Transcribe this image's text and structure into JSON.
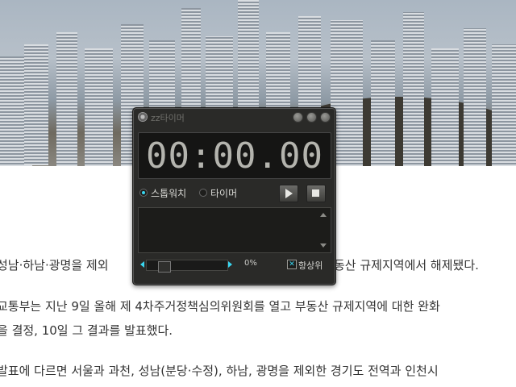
{
  "window": {
    "title": "zz타이머"
  },
  "display": {
    "time": "00:00.00"
  },
  "modes": [
    {
      "label": "스톱워치",
      "selected": true
    },
    {
      "label": "타이머",
      "selected": false
    }
  ],
  "controls": {
    "play": "play-icon",
    "stop": "stop-icon"
  },
  "bottom": {
    "opacity_percent": "0%",
    "always_on_top_label": "항상위",
    "always_on_top_checked": true
  },
  "article": {
    "line1_left": "성남·하남·광명을 제외",
    "line1_right": "동산 규제지역에서 해제됐다.",
    "line2": "교통부는 지난 9일 올해 제 4차주거정책심의위원회를 열고 부동산 규제지역에 대한 완화",
    "line3": "을 결정, 10일 그 결과를 발표했다.",
    "line4": "발표에 다르면 서울과 과천, 성남(분당·수정), 하남, 광명을 제외한 경기도 전역과 인천시"
  },
  "colors": {
    "accent": "#39d6f0",
    "window_bg": "#2a2a28"
  }
}
